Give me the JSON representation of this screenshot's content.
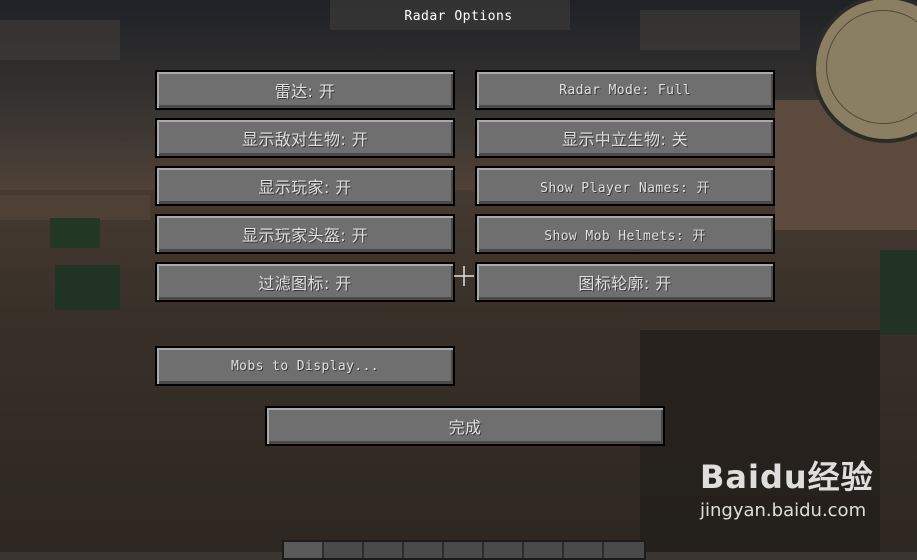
{
  "screen_title": "Radar Options",
  "buttons": {
    "radar": "雷达: 开",
    "radar_mode": "Radar Mode: Full",
    "show_hostile": "显示敌对生物: 开",
    "show_neutral": "显示中立生物: 关",
    "show_players": "显示玩家: 开",
    "show_player_names": "Show Player Names: 开",
    "show_player_helmets": "显示玩家头盔: 开",
    "show_mob_helmets": "Show Mob Helmets: 开",
    "filter_icons": "过滤图标: 开",
    "icon_outlines": "图标轮廓: 开",
    "mobs_to_display": "Mobs to Display...",
    "done": "完成"
  },
  "watermark": {
    "brand": "Baidu经验",
    "url": "jingyan.baidu.com"
  }
}
